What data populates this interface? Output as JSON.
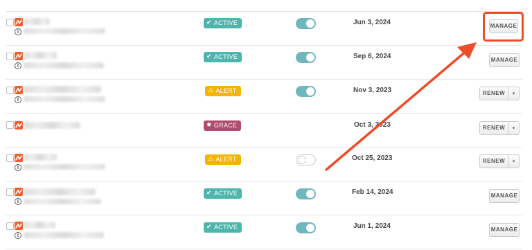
{
  "colors": {
    "active": "#4db6ac",
    "alert": "#f5b400",
    "grace": "#b04a6e",
    "toggle_on": "#6fb6bd",
    "annotation": "#ef4a2a"
  },
  "rows": [
    {
      "status": "ACTIVE",
      "status_icon": "check-icon",
      "toggle": "on",
      "date": "Jun 3, 2024",
      "action": "MANAGE"
    },
    {
      "status": "ACTIVE",
      "status_icon": "check-icon",
      "toggle": "on",
      "date": "Sep 6, 2024",
      "action": "MANAGE"
    },
    {
      "status": "ALERT",
      "status_icon": "warning-icon",
      "toggle": "on",
      "date": "Nov 3, 2023",
      "action": "RENEW"
    },
    {
      "status": "GRACE",
      "status_icon": "bug-icon",
      "toggle": null,
      "date": "Oct 3, 2023",
      "action": "RENEW"
    },
    {
      "status": "ALERT",
      "status_icon": "warning-icon",
      "toggle": "off",
      "date": "Oct 25, 2023",
      "action": "RENEW"
    },
    {
      "status": "ACTIVE",
      "status_icon": "check-icon",
      "toggle": "on",
      "date": "Feb 14, 2024",
      "action": "MANAGE"
    },
    {
      "status": "ACTIVE",
      "status_icon": "check-icon",
      "toggle": "on",
      "date": "Jun 1, 2024",
      "action": "MANAGE"
    }
  ],
  "info_glyph": "i",
  "caret_glyph": "▾",
  "icons": {
    "check": "✔",
    "warning": "⚠",
    "bug": "✹"
  }
}
